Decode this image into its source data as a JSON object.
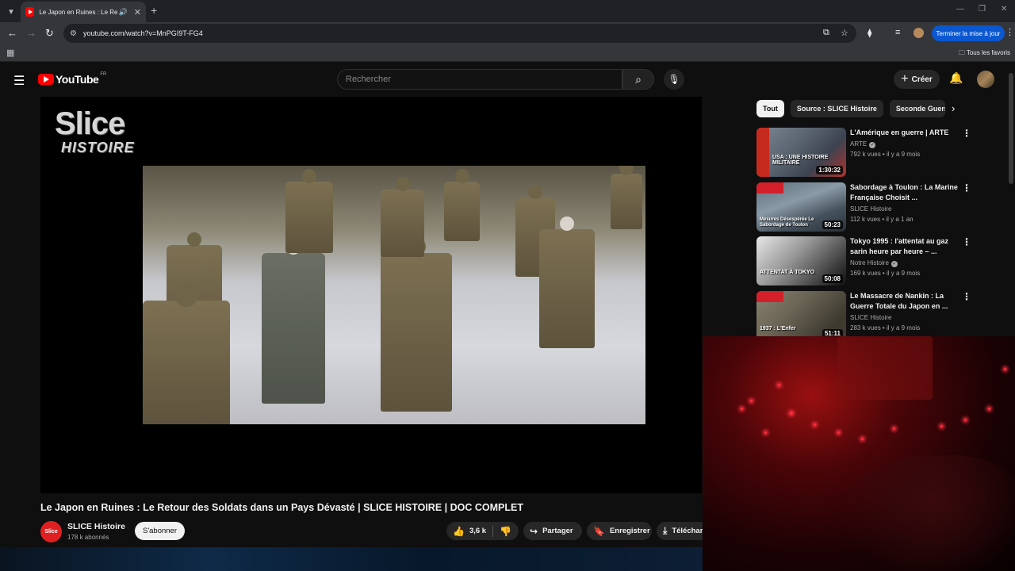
{
  "browser": {
    "tab_title": "Le Japon en Ruines : Le Retour",
    "url": "youtube.com/watch?v=MnPGI9T-FG4",
    "update_button": "Terminer la mise à jour",
    "bookmarks_all": "Tous les favoris"
  },
  "youtube": {
    "logo_text": "YouTube",
    "region": "FR",
    "search_placeholder": "Rechercher",
    "create_label": "Créer"
  },
  "video": {
    "overlay_brand_line1": "Slice",
    "overlay_brand_line2": "HISTOIRE",
    "title": "Le Japon en Ruines : Le Retour des Soldats dans un Pays Dévasté | SLICE HISTOIRE | DOC COMPLET",
    "channel_avatar_text": "Slice",
    "channel_name": "SLICE Histoire",
    "subscribers": "178 k abonnés",
    "subscribe_label": "S'abonner",
    "likes": "3,6 k",
    "share_label": "Partager",
    "save_label": "Enregistrer",
    "download_label": "Téléchar"
  },
  "chips": [
    "Tout",
    "Source : SLICE Histoire",
    "Seconde Guerre"
  ],
  "recommendations": [
    {
      "title_line1": "L'Amérique en guerre | ARTE",
      "title_line2": "",
      "channel": "ARTE",
      "verified": true,
      "views": "792 k vues",
      "age": "il y a 9 mois",
      "duration": "1:30:32",
      "thumb_text": "USA : UNE HISTOIRE MILITAIRE"
    },
    {
      "title_line1": "Sabordage à Toulon : La Marine",
      "title_line2": "Française Choisit ...",
      "channel": "SLICE Histoire",
      "verified": false,
      "views": "112 k vues",
      "age": "il y a 1 an",
      "duration": "50:23",
      "thumb_text": "Mesures Désespérée Le Sabordage de Toulon"
    },
    {
      "title_line1": "Tokyo 1995 : l'attentat au gaz",
      "title_line2": "sarin heure par heure – ...",
      "channel": "Notre Histoire",
      "verified": true,
      "views": "169 k vues",
      "age": "il y a 9 mois",
      "duration": "50:08",
      "thumb_text": "ATTENTAT À TOKYO"
    },
    {
      "title_line1": "Le Massacre de Nankin : La",
      "title_line2": "Guerre Totale du Japon en ...",
      "channel": "SLICE Histoire",
      "verified": false,
      "views": "283 k vues",
      "age": "il y a 9 mois",
      "duration": "51:11",
      "thumb_text": "1937 : L'Enfer"
    }
  ],
  "colors": {
    "accent": "#ff0000",
    "background": "#0f0f0f",
    "update_button": "#0b57d0",
    "webcam_glow": "#ff2a3a"
  }
}
